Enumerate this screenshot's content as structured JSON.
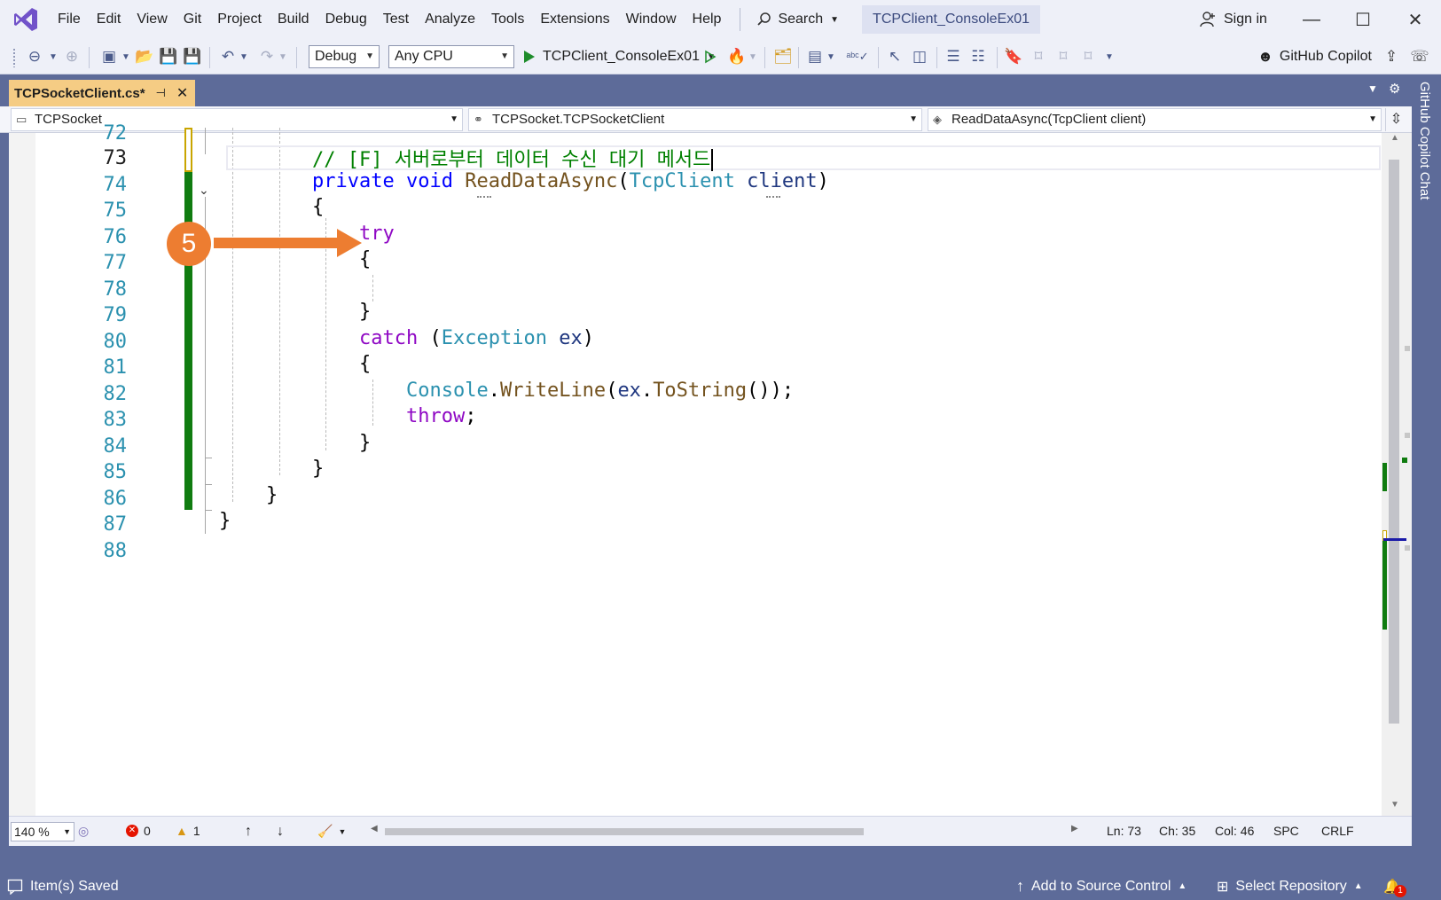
{
  "menu": {
    "items": [
      "File",
      "Edit",
      "View",
      "Git",
      "Project",
      "Build",
      "Debug",
      "Test",
      "Analyze",
      "Tools",
      "Extensions",
      "Window",
      "Help"
    ],
    "search_label": "Search",
    "solution_name": "TCPClient_ConsoleEx01",
    "sign_in": "Sign in"
  },
  "toolbar": {
    "configuration": "Debug",
    "platform": "Any CPU",
    "startup_project": "TCPClient_ConsoleEx01",
    "copilot_label": "GitHub Copilot"
  },
  "tab": {
    "file_name": "TCPSocketClient.cs*"
  },
  "side_panel": {
    "label": "GitHub Copilot Chat"
  },
  "navbar": {
    "project": "TCPSocket",
    "type": "TCPSocket.TCPSocketClient",
    "member": "ReadDataAsync(TcpClient client)"
  },
  "editor": {
    "line_numbers": [
      "72",
      "73",
      "74",
      "75",
      "76",
      "77",
      "78",
      "79",
      "80",
      "81",
      "82",
      "83",
      "84",
      "85",
      "86",
      "87",
      "88"
    ],
    "current_line": "73",
    "code": {
      "comment": "// [F] 서버로부터 데이터 수신 대기 메서드",
      "kw_private": "private",
      "kw_void": "void",
      "method": "ReadDataAsync",
      "paren_open": "(",
      "param_type": "TcpClient",
      "param_name": "client",
      "paren_close": ")",
      "brace_open": "{",
      "brace_close": "}",
      "kw_try": "try",
      "kw_catch": "catch",
      "exception_type": "Exception",
      "exception_var": "ex",
      "console": "Console",
      "dot": ".",
      "writeline": "WriteLine",
      "tostring": "ToString",
      "call_tail": "());",
      "kw_throw": "throw",
      "semicolon": ";"
    },
    "step_badge": "5"
  },
  "editor_status": {
    "zoom": "140 %",
    "errors": "0",
    "warnings": "1",
    "ln": "Ln: 73",
    "ch": "Ch: 35",
    "col": "Col: 46",
    "whitespace": "SPC",
    "line_ending": "CRLF"
  },
  "statusbar": {
    "message": "Item(s) Saved",
    "source_control": "Add to Source Control",
    "repository": "Select Repository",
    "notifications": "1"
  },
  "colors": {
    "accent_orange": "#ed7d31",
    "frame": "#5d6b99",
    "tab_active": "#f5cc84",
    "change_saved": "#107c10",
    "change_unsaved": "#c9a500"
  }
}
